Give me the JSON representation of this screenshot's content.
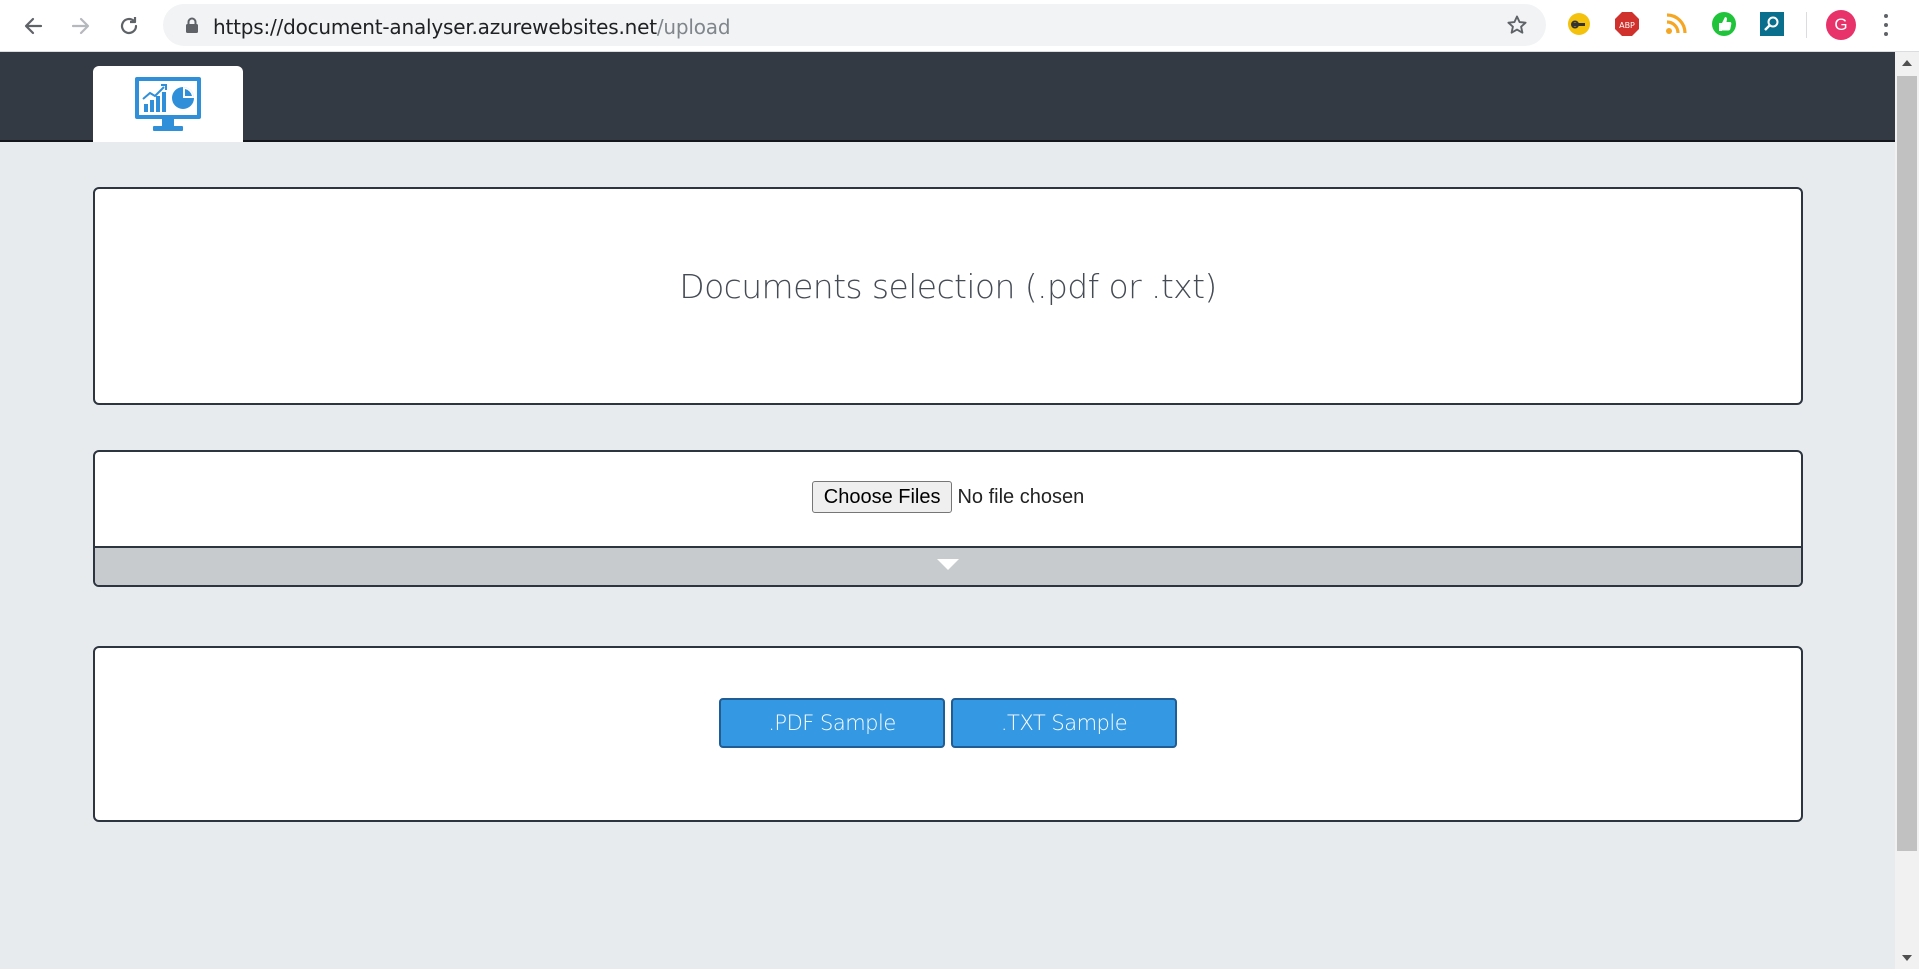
{
  "browser": {
    "url_host": "https://document-analyser.azurewebsites.net",
    "url_path": "/upload",
    "profile_initial": "G",
    "extensions": [
      "key-extension-icon",
      "adblock-icon",
      "rss-feed-icon",
      "thumbs-up-extension-icon",
      "search-extension-icon"
    ]
  },
  "app": {
    "logo": "analytics-monitor-logo"
  },
  "selection_panel": {
    "title": "Documents selection (.pdf or .txt)"
  },
  "file_input": {
    "button_label": "Choose Files",
    "status": "No file chosen"
  },
  "samples": {
    "pdf_label": ".PDF Sample",
    "txt_label": ".TXT Sample"
  },
  "colors": {
    "header_bg": "#343a44",
    "page_bg": "#e8ebee",
    "accent_button": "#3499e2",
    "logo_blue": "#2f8fd8"
  }
}
